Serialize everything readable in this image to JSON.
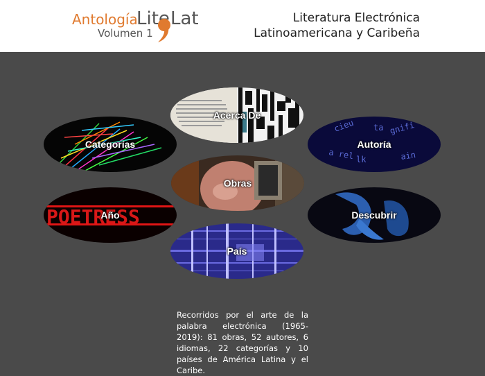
{
  "logo": {
    "antologia": "Antología",
    "lite": "Lite",
    "lat": "Lat",
    "volumen": "Volumen 1",
    "accent_color": "#e07a2f"
  },
  "site_title": {
    "line1": "Literatura Electrónica",
    "line2": "Latinoamericana y Caribeña"
  },
  "nav": {
    "acerca": "Acerca De",
    "categorias": "Categorías",
    "autoria": "Autoría",
    "obras": "Obras",
    "anio": "Año",
    "descubrir": "Descubrir",
    "pais": "País"
  },
  "blurb": "Recorridos por el arte de la palabra electrónica (1965-2019): 81 obras, 52 autores, 6 idiomas, 22 categorías y 10 países de América Latina y el Caribe."
}
